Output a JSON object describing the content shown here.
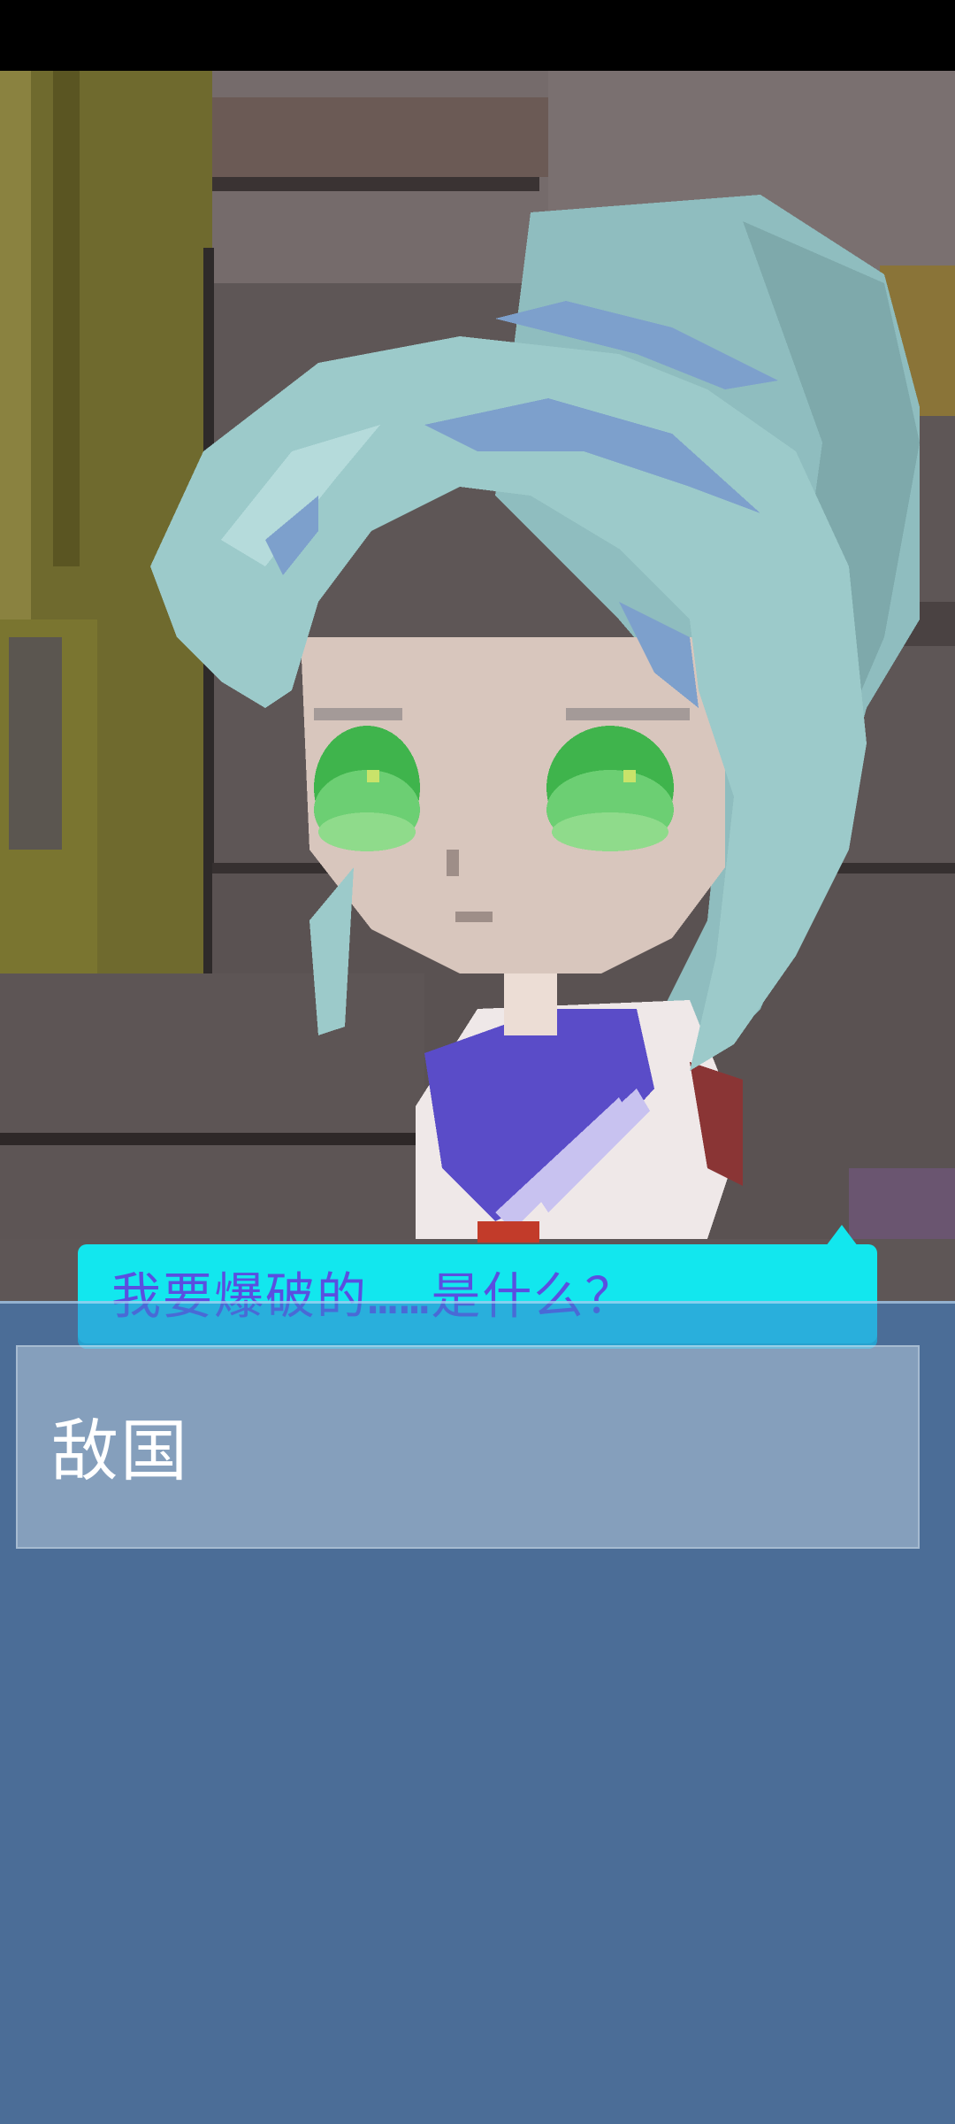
{
  "dialogue": {
    "text": "我要爆破的……是什么？"
  },
  "choices": [
    {
      "label": "敌国"
    }
  ],
  "colors": {
    "bubble": "#12e7ee",
    "bubble_text": "#5a4fe0",
    "overlay": "#3c82cd",
    "hair": "#9ccaca",
    "eyes": "#6ccf73",
    "uniform_collar": "#5a4cc8",
    "background_wall": "#5e5656",
    "background_cabinet": "#6f6a2e"
  },
  "icons": {
    "bubble_tail": "triangle-up"
  }
}
